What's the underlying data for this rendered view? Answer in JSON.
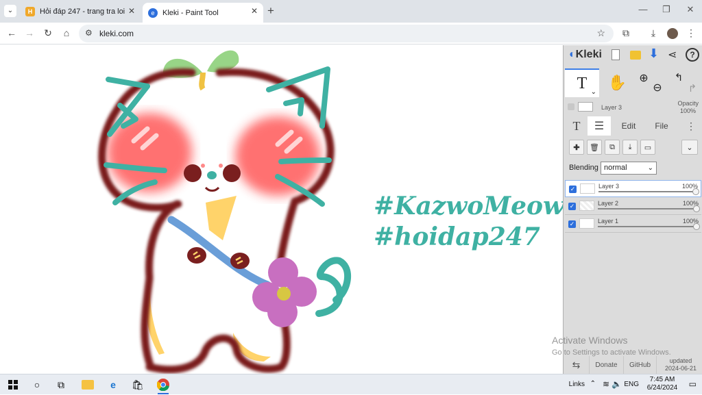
{
  "browser": {
    "tabs": [
      {
        "title": "Hỏi đáp 247 - trang tra loi",
        "active": false,
        "favicon": "hoidap-favicon"
      },
      {
        "title": "Kleki - Paint Tool",
        "active": true,
        "favicon": "kleki-favicon"
      }
    ],
    "new_tab_symbol": "+",
    "url": "kleki.com"
  },
  "canvas": {
    "hashtags": [
      "#KazwoMeow",
      "#hoidap247"
    ],
    "text_color": "#3fb1a3"
  },
  "kleki": {
    "brand": "Kleki",
    "current_layer": {
      "name": "Layer 3",
      "opacity_label": "Opacity",
      "opacity": "100%"
    },
    "tabs": {
      "edit": "Edit",
      "file": "File"
    },
    "blending_label": "Blending",
    "blending_value": "normal",
    "layers": [
      {
        "name": "Layer 3",
        "opacity": "100%",
        "selected": true
      },
      {
        "name": "Layer 2",
        "opacity": "100%",
        "selected": false
      },
      {
        "name": "Layer 1",
        "opacity": "100%",
        "selected": false
      }
    ],
    "footer": {
      "donate": "Donate",
      "github": "GitHub",
      "updated_label": "updated",
      "updated_date": "2024-06-21"
    }
  },
  "watermark": {
    "title": "Activate Windows",
    "subtitle": "Go to Settings to activate Windows."
  },
  "taskbar": {
    "links_label": "Links",
    "language": "ENG",
    "time": "7:45 AM",
    "date": "6/24/2024"
  },
  "colors": {
    "accent": "#2d6fdc",
    "cat_outline": "#7a1f1f",
    "cat_teal": "#3fb1a3",
    "flower": "#c86fc0",
    "cheek": "#ff6b6b"
  }
}
